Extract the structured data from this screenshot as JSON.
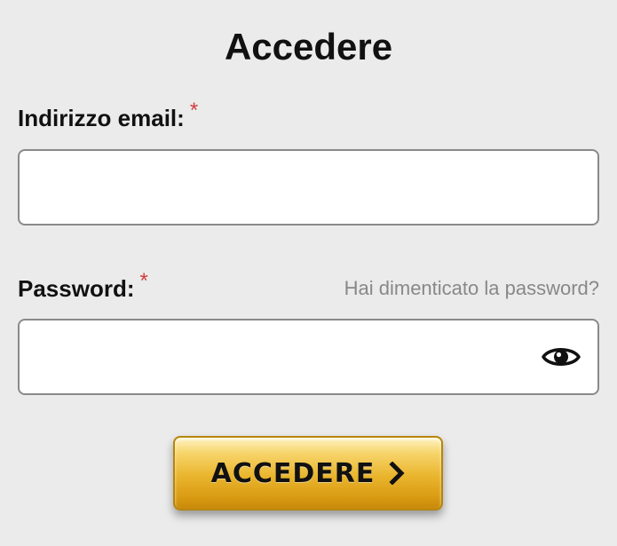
{
  "form": {
    "title": "Accedere",
    "email": {
      "label": "Indirizzo email:",
      "required_mark": "*",
      "value": "",
      "placeholder": ""
    },
    "password": {
      "label": "Password:",
      "required_mark": "*",
      "value": "",
      "placeholder": "",
      "toggle_icon": "eye-icon"
    },
    "forgot_password_link": "Hai dimenticato la password?",
    "submit": {
      "label": "ACCEDERE",
      "icon": "chevron-right-icon"
    }
  },
  "colors": {
    "background": "#ebebeb",
    "required": "#d23c3c",
    "link": "#888888",
    "button_gold": "#e9b42c"
  }
}
